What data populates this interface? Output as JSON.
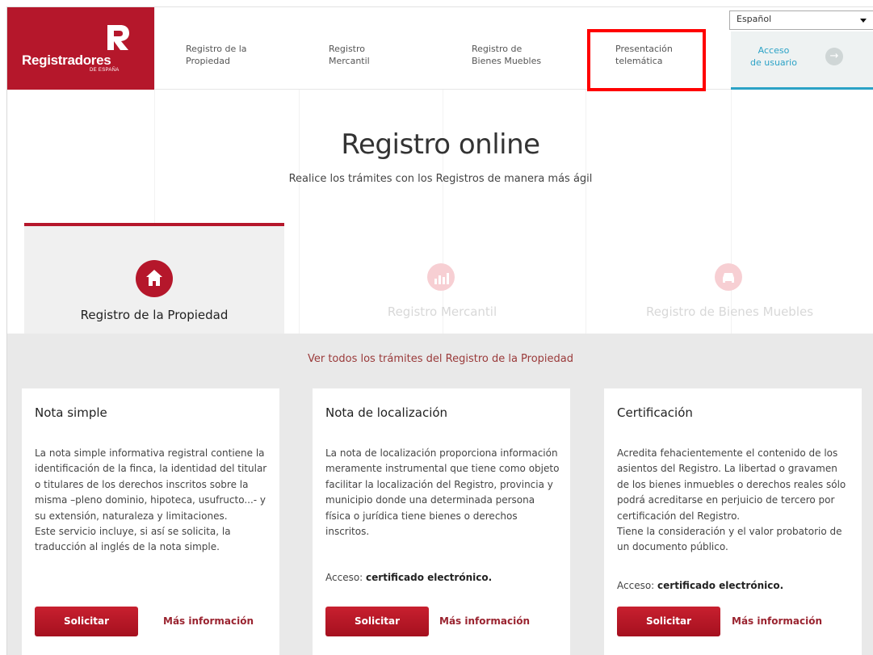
{
  "brand": {
    "name": "Registradores",
    "sub": "DE ESPAÑA",
    "color": "#b5172b"
  },
  "nav": [
    {
      "label": "Registro de la Propiedad"
    },
    {
      "label": "Registro Mercantil"
    },
    {
      "label": "Registro de Bienes Muebles"
    },
    {
      "label": "Presentación telemática"
    }
  ],
  "language": {
    "selected": "Español"
  },
  "access": {
    "label_1": "Acceso",
    "label_2": "de usuario",
    "icon": "arrow-right-icon",
    "color": "#2ba2c6"
  },
  "hero": {
    "title": "Registro online",
    "subtitle": "Realice los trámites con los Registros de manera más ágil"
  },
  "tabs": [
    {
      "label": "Registro de la Propiedad",
      "icon": "home-icon",
      "active": true
    },
    {
      "label": "Registro Mercantil",
      "icon": "chart-icon",
      "active": false
    },
    {
      "label": "Registro de Bienes Muebles",
      "icon": "car-icon",
      "active": false
    }
  ],
  "all_link": "Ver todos los trámites del Registro de la Propiedad",
  "cards": [
    {
      "title": "Nota simple",
      "body": "La nota simple informativa registral contiene la identificación de la finca, la identidad del titular o titulares de los derechos inscritos sobre la misma –pleno dominio, hipoteca, usufructo...- y su extensión, naturaleza y limitaciones.\nEste servicio incluye, si así se solicita, la traducción al inglés de la nota simple.",
      "access_label": "",
      "access_value": "",
      "button": "Solicitar",
      "more": "Más información"
    },
    {
      "title": "Nota de localización",
      "body": "La nota de localización proporciona información meramente instrumental que tiene como objeto facilitar la localización del Registro, provincia y municipio donde una determinada persona física o jurídica tiene bienes o derechos inscritos.",
      "access_label": "Acceso: ",
      "access_value": "certificado electrónico.",
      "button": "Solicitar",
      "more": "Más información"
    },
    {
      "title": "Certificación",
      "body": "Acredita fehacientemente el contenido de los asientos del Registro. La libertad o gravamen de los bienes inmuebles o derechos reales sólo podrá acreditarse en perjuicio de tercero por certificación del Registro.\nTiene la consideración y el valor probatorio de un documento público.",
      "access_label": "Acceso: ",
      "access_value": "certificado electrónico.",
      "button": "Solicitar",
      "more": "Más información"
    }
  ]
}
